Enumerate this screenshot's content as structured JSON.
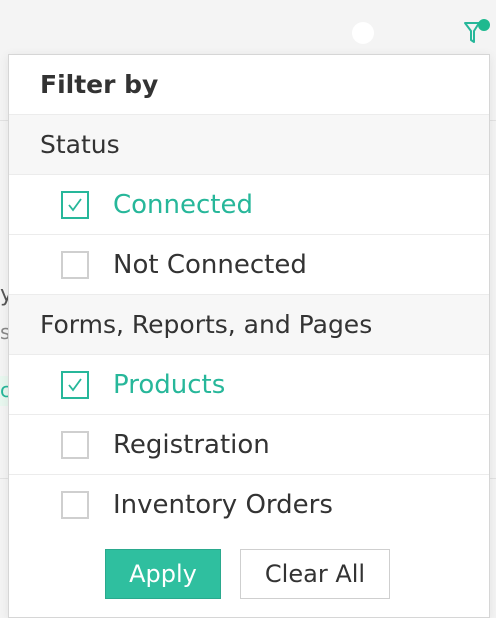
{
  "background": {
    "fragment_y": "y",
    "fragment_s": "s",
    "fragment_c": "c"
  },
  "filter_icon": {
    "name": "filter-icon",
    "badge_color": "#1fb98f"
  },
  "panel": {
    "title": "Filter by",
    "sections": [
      {
        "title": "Status",
        "options": [
          {
            "label": "Connected",
            "checked": true
          },
          {
            "label": "Not Connected",
            "checked": false
          }
        ]
      },
      {
        "title": "Forms, Reports, and Pages",
        "options": [
          {
            "label": "Products",
            "checked": true
          },
          {
            "label": "Registration",
            "checked": false
          },
          {
            "label": "Inventory Orders",
            "checked": false
          }
        ]
      }
    ],
    "apply_label": "Apply",
    "clear_label": "Clear All"
  },
  "colors": {
    "accent": "#27b79a",
    "apply_bg": "#2fbf9f",
    "text": "#333333"
  }
}
